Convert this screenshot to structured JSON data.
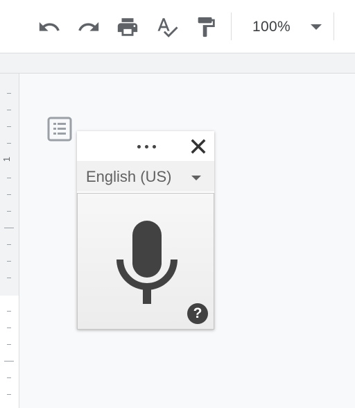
{
  "toolbar": {
    "zoom_value": "100%",
    "icons": [
      "undo-icon",
      "redo-icon",
      "print-icon",
      "spellcheck-icon",
      "paint-format-icon"
    ]
  },
  "ruler": {
    "number_label": "1"
  },
  "voice_typing": {
    "language": "English (US)",
    "help_label": "?",
    "mic_color": "#424242"
  },
  "colors": {
    "icon": "#5f6368",
    "canvas": "#f8f9fa"
  }
}
